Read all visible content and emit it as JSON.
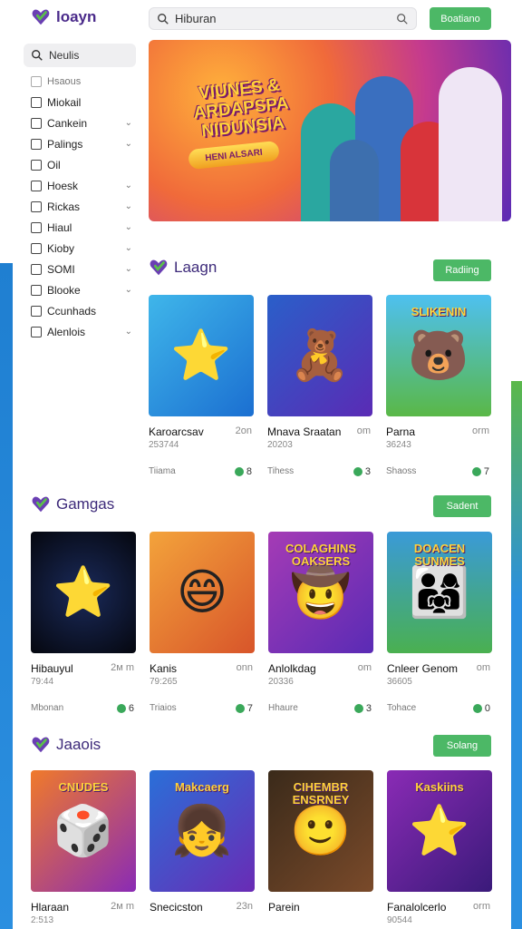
{
  "header": {
    "logo_text": "loayn",
    "search_value": "Hiburan",
    "top_button": "Boatiano"
  },
  "sidebar": {
    "search_value": "Neulis",
    "items": [
      {
        "label": "Hsaous",
        "chevron": false,
        "muted": true
      },
      {
        "label": "Miokail",
        "chevron": false
      },
      {
        "label": "Cankein",
        "chevron": true
      },
      {
        "label": "Palings",
        "chevron": true
      },
      {
        "label": "Oil",
        "chevron": false
      },
      {
        "label": "Hoesk",
        "chevron": true
      },
      {
        "label": "Rickas",
        "chevron": true
      },
      {
        "label": "Hiaul",
        "chevron": true
      },
      {
        "label": "Kioby",
        "chevron": true
      },
      {
        "label": "SOMI",
        "chevron": true
      },
      {
        "label": "Blooke",
        "chevron": true
      },
      {
        "label": "Ccunhads",
        "chevron": false
      },
      {
        "label": "Alenlois",
        "chevron": true
      }
    ]
  },
  "banner": {
    "title": "VIUNES & ARDAPSPA NIDUNSIA",
    "subtitle": "HENI ALSARI"
  },
  "sections": [
    {
      "title": "Laagn",
      "button": "Radiing",
      "cards": [
        {
          "title": "Karoarcsav",
          "right": "2on",
          "sub": "253744",
          "meta": "Tiiama",
          "badge": "8",
          "caption": "",
          "glyph": "⭐"
        },
        {
          "title": "Mnava Sraatan",
          "right": "om",
          "sub": "20203",
          "meta": "Tihess",
          "badge": "3",
          "caption": "",
          "glyph": "🧸"
        },
        {
          "title": "Parna",
          "right": "orm",
          "sub": "36243",
          "meta": "Shaoss",
          "badge": "7",
          "caption": "SLIKENIN",
          "glyph": "🐻"
        }
      ]
    },
    {
      "title": "Gamgas",
      "button": "Sadent",
      "cards": [
        {
          "title": "Hibauyul",
          "right": "2м m",
          "sub": "79:44",
          "meta": "Mbonan",
          "badge": "6",
          "caption": "",
          "glyph": "⭐"
        },
        {
          "title": "Kanis",
          "right": "onn",
          "sub": "79:265",
          "meta": "Triaios",
          "badge": "7",
          "caption": "",
          "glyph": "😄"
        },
        {
          "title": "Anlolkdag",
          "right": "om",
          "sub": "20336",
          "meta": "Hhaure",
          "badge": "3",
          "caption": "COLAGHINS OAKSERS",
          "glyph": "🤠"
        },
        {
          "title": "Cnleer Genom",
          "right": "om",
          "sub": "36605",
          "meta": "Tohace",
          "badge": "0",
          "caption": "DOACEN SUNMES",
          "glyph": "👨‍👩‍👧"
        }
      ]
    },
    {
      "title": "Jaaois",
      "button": "Solang",
      "cards": [
        {
          "title": "Hlaraan",
          "right": "2м m",
          "sub": "2:513",
          "meta": "",
          "badge": "",
          "caption": "CNUDES",
          "glyph": "🎲"
        },
        {
          "title": "Snecicston",
          "right": "23n",
          "sub": "",
          "meta": "",
          "badge": "",
          "caption": "Makcaerg",
          "glyph": "👧"
        },
        {
          "title": "Parein",
          "right": "",
          "sub": "",
          "meta": "",
          "badge": "",
          "caption": "CIHEMBR ENSRNEY",
          "glyph": "🙂"
        },
        {
          "title": "Fanalolcerlo",
          "right": "orm",
          "sub": "90544",
          "meta": "",
          "badge": "",
          "caption": "Kaskiins",
          "glyph": "⭐"
        }
      ]
    }
  ],
  "colors": {
    "accent_green": "#4cb866",
    "brand_purple": "#4a2a8a",
    "side_band_blue": "#2b8fe0"
  }
}
